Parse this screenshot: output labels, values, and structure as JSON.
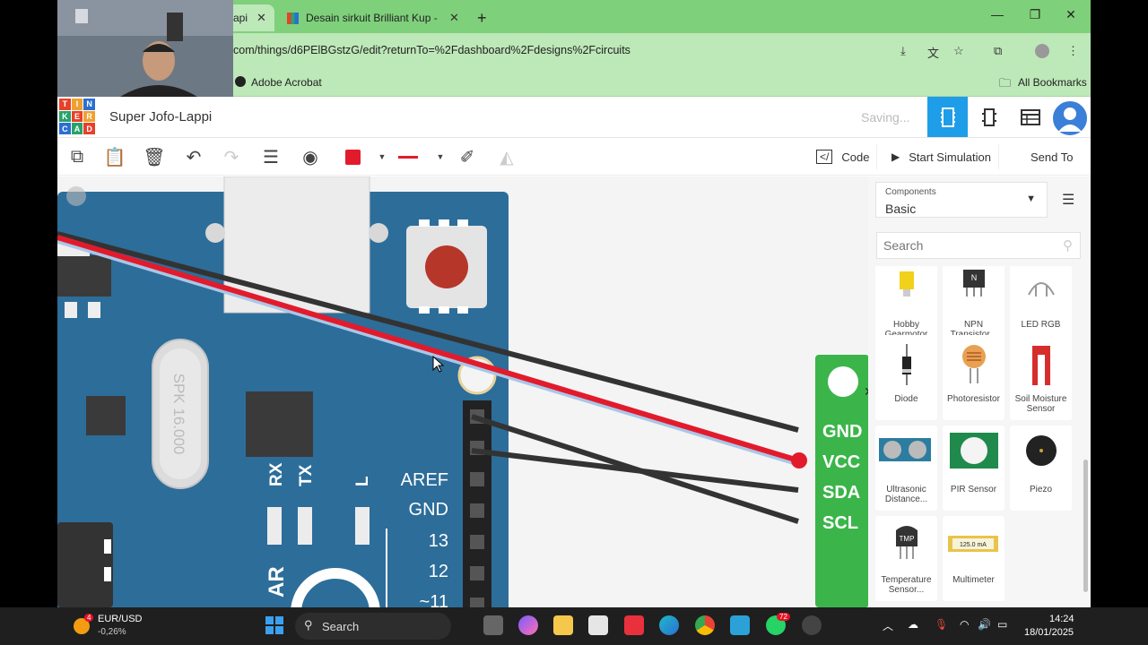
{
  "browser": {
    "tabs": [
      {
        "label": "api",
        "active": true
      },
      {
        "label": "Desain sirkuit Brilliant Kup - Tin",
        "active": false
      }
    ],
    "new_tab": "+",
    "url": "com/things/d6PElBGstzG/edit?returnTo=%2Fdashboard%2Fdesigns%2Fcircuits",
    "bookmarks": [
      "Adobe Acrobat"
    ],
    "all_bookmarks": "All Bookmarks"
  },
  "app": {
    "logo_letters": [
      "T",
      "I",
      "N",
      "K",
      "E",
      "R",
      "C",
      "A",
      "D"
    ],
    "logo_colors": [
      "#e6412a",
      "#f0a030",
      "#2b6fd1",
      "#29a36a",
      "#e6412a",
      "#f0a030",
      "#2b6fd1",
      "#29a36a",
      "#e6412a"
    ],
    "title": "Super Jofo-Lappi",
    "status": "Saving...",
    "accent": "#1e9ee8"
  },
  "toolbar": {
    "code": "Code",
    "start_simulation": "Start Simulation",
    "send_to": "Send To",
    "wire_color": "#e21b2c"
  },
  "canvas": {
    "header_labels": [
      "AREF",
      "GND",
      "13",
      "12",
      "~11"
    ],
    "led_labels": [
      "RX",
      "TX",
      "L"
    ],
    "crystal_text": "SPK 16.000",
    "module_pins": [
      "GND",
      "VCC",
      "SDA",
      "SCL"
    ]
  },
  "components": {
    "label": "Components",
    "selected": "Basic",
    "search_placeholder": "Search",
    "items": [
      {
        "name": "Hobby Gearmotor",
        "icon": "gearmotor-icon"
      },
      {
        "name": "NPN Transistor...",
        "icon": "npn-transistor-icon"
      },
      {
        "name": "LED RGB",
        "icon": "led-rgb-icon"
      },
      {
        "name": "Diode",
        "icon": "diode-icon"
      },
      {
        "name": "Photoresistor",
        "icon": "photoresistor-icon"
      },
      {
        "name": "Soil Moisture Sensor",
        "icon": "soil-moisture-icon"
      },
      {
        "name": "Ultrasonic Distance...",
        "icon": "ultrasonic-icon"
      },
      {
        "name": "PIR Sensor",
        "icon": "pir-icon"
      },
      {
        "name": "Piezo",
        "icon": "piezo-icon"
      },
      {
        "name": "Temperature Sensor...",
        "icon": "temperature-sensor-icon"
      },
      {
        "name": "Multimeter",
        "icon": "multimeter-icon"
      }
    ],
    "multimeter_reading": "125.0 mA",
    "tmp_label": "TMP",
    "npn_label": "N"
  },
  "taskbar": {
    "ticker_name": "EUR/USD",
    "ticker_value": "-0,26%",
    "ticker_badge": "4",
    "search": "Search",
    "whatsapp_badge": "72",
    "time": "14:24",
    "date": "18/01/2025"
  }
}
